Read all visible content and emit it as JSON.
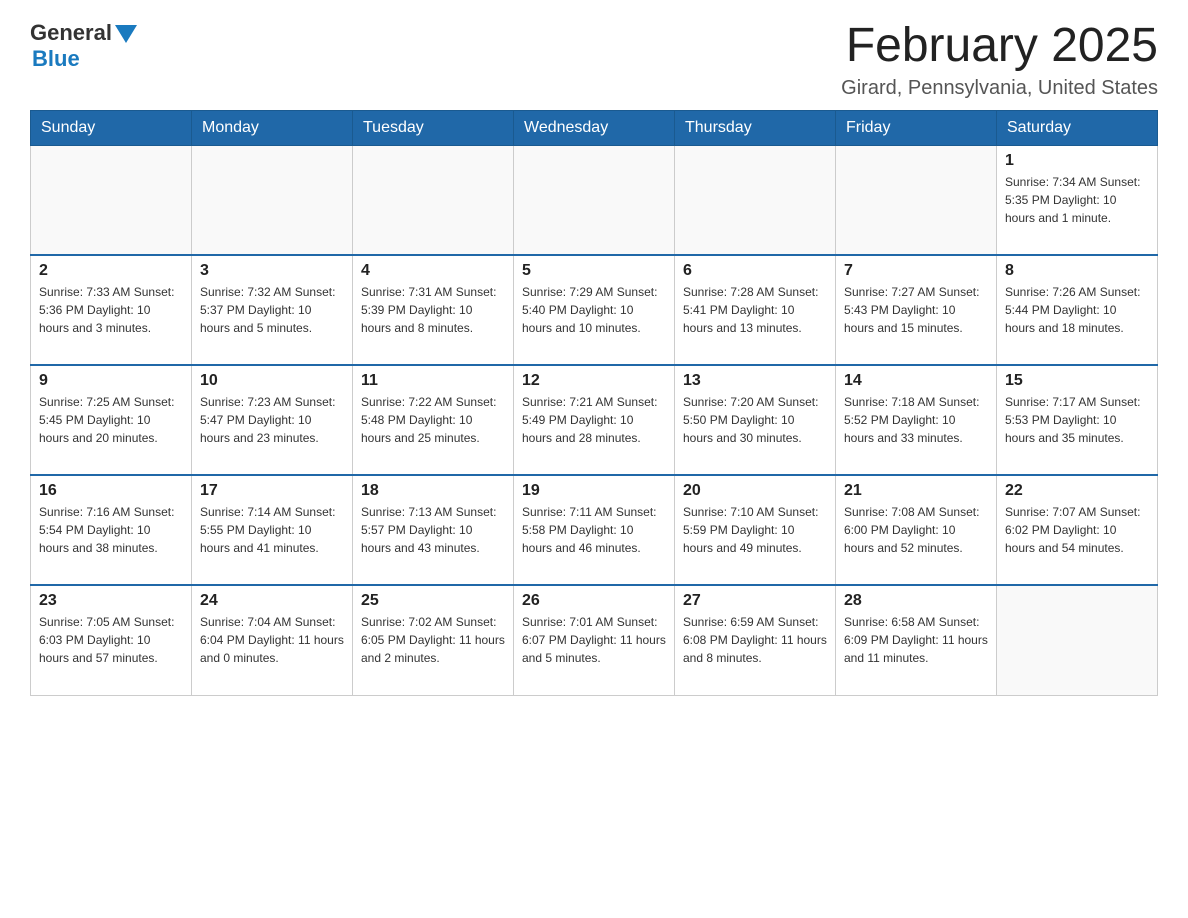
{
  "header": {
    "logo": {
      "general": "General",
      "blue": "Blue"
    },
    "title": "February 2025",
    "location": "Girard, Pennsylvania, United States"
  },
  "calendar": {
    "days_of_week": [
      "Sunday",
      "Monday",
      "Tuesday",
      "Wednesday",
      "Thursday",
      "Friday",
      "Saturday"
    ],
    "weeks": [
      {
        "days": [
          {
            "number": "",
            "info": ""
          },
          {
            "number": "",
            "info": ""
          },
          {
            "number": "",
            "info": ""
          },
          {
            "number": "",
            "info": ""
          },
          {
            "number": "",
            "info": ""
          },
          {
            "number": "",
            "info": ""
          },
          {
            "number": "1",
            "info": "Sunrise: 7:34 AM\nSunset: 5:35 PM\nDaylight: 10 hours\nand 1 minute."
          }
        ]
      },
      {
        "days": [
          {
            "number": "2",
            "info": "Sunrise: 7:33 AM\nSunset: 5:36 PM\nDaylight: 10 hours\nand 3 minutes."
          },
          {
            "number": "3",
            "info": "Sunrise: 7:32 AM\nSunset: 5:37 PM\nDaylight: 10 hours\nand 5 minutes."
          },
          {
            "number": "4",
            "info": "Sunrise: 7:31 AM\nSunset: 5:39 PM\nDaylight: 10 hours\nand 8 minutes."
          },
          {
            "number": "5",
            "info": "Sunrise: 7:29 AM\nSunset: 5:40 PM\nDaylight: 10 hours\nand 10 minutes."
          },
          {
            "number": "6",
            "info": "Sunrise: 7:28 AM\nSunset: 5:41 PM\nDaylight: 10 hours\nand 13 minutes."
          },
          {
            "number": "7",
            "info": "Sunrise: 7:27 AM\nSunset: 5:43 PM\nDaylight: 10 hours\nand 15 minutes."
          },
          {
            "number": "8",
            "info": "Sunrise: 7:26 AM\nSunset: 5:44 PM\nDaylight: 10 hours\nand 18 minutes."
          }
        ]
      },
      {
        "days": [
          {
            "number": "9",
            "info": "Sunrise: 7:25 AM\nSunset: 5:45 PM\nDaylight: 10 hours\nand 20 minutes."
          },
          {
            "number": "10",
            "info": "Sunrise: 7:23 AM\nSunset: 5:47 PM\nDaylight: 10 hours\nand 23 minutes."
          },
          {
            "number": "11",
            "info": "Sunrise: 7:22 AM\nSunset: 5:48 PM\nDaylight: 10 hours\nand 25 minutes."
          },
          {
            "number": "12",
            "info": "Sunrise: 7:21 AM\nSunset: 5:49 PM\nDaylight: 10 hours\nand 28 minutes."
          },
          {
            "number": "13",
            "info": "Sunrise: 7:20 AM\nSunset: 5:50 PM\nDaylight: 10 hours\nand 30 minutes."
          },
          {
            "number": "14",
            "info": "Sunrise: 7:18 AM\nSunset: 5:52 PM\nDaylight: 10 hours\nand 33 minutes."
          },
          {
            "number": "15",
            "info": "Sunrise: 7:17 AM\nSunset: 5:53 PM\nDaylight: 10 hours\nand 35 minutes."
          }
        ]
      },
      {
        "days": [
          {
            "number": "16",
            "info": "Sunrise: 7:16 AM\nSunset: 5:54 PM\nDaylight: 10 hours\nand 38 minutes."
          },
          {
            "number": "17",
            "info": "Sunrise: 7:14 AM\nSunset: 5:55 PM\nDaylight: 10 hours\nand 41 minutes."
          },
          {
            "number": "18",
            "info": "Sunrise: 7:13 AM\nSunset: 5:57 PM\nDaylight: 10 hours\nand 43 minutes."
          },
          {
            "number": "19",
            "info": "Sunrise: 7:11 AM\nSunset: 5:58 PM\nDaylight: 10 hours\nand 46 minutes."
          },
          {
            "number": "20",
            "info": "Sunrise: 7:10 AM\nSunset: 5:59 PM\nDaylight: 10 hours\nand 49 minutes."
          },
          {
            "number": "21",
            "info": "Sunrise: 7:08 AM\nSunset: 6:00 PM\nDaylight: 10 hours\nand 52 minutes."
          },
          {
            "number": "22",
            "info": "Sunrise: 7:07 AM\nSunset: 6:02 PM\nDaylight: 10 hours\nand 54 minutes."
          }
        ]
      },
      {
        "days": [
          {
            "number": "23",
            "info": "Sunrise: 7:05 AM\nSunset: 6:03 PM\nDaylight: 10 hours\nand 57 minutes."
          },
          {
            "number": "24",
            "info": "Sunrise: 7:04 AM\nSunset: 6:04 PM\nDaylight: 11 hours\nand 0 minutes."
          },
          {
            "number": "25",
            "info": "Sunrise: 7:02 AM\nSunset: 6:05 PM\nDaylight: 11 hours\nand 2 minutes."
          },
          {
            "number": "26",
            "info": "Sunrise: 7:01 AM\nSunset: 6:07 PM\nDaylight: 11 hours\nand 5 minutes."
          },
          {
            "number": "27",
            "info": "Sunrise: 6:59 AM\nSunset: 6:08 PM\nDaylight: 11 hours\nand 8 minutes."
          },
          {
            "number": "28",
            "info": "Sunrise: 6:58 AM\nSunset: 6:09 PM\nDaylight: 11 hours\nand 11 minutes."
          },
          {
            "number": "",
            "info": ""
          }
        ]
      }
    ]
  }
}
